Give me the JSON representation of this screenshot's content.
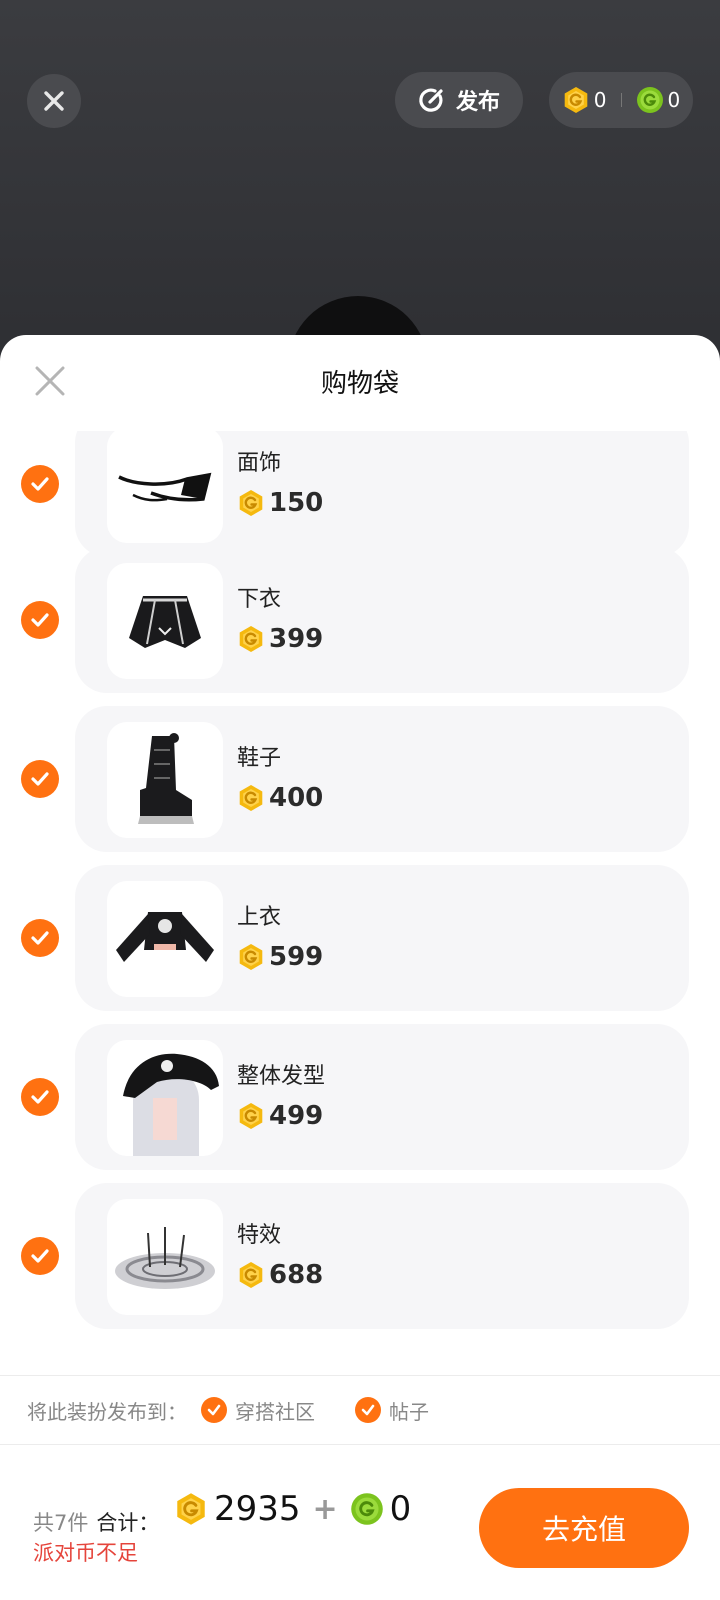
{
  "topbar": {
    "publish_label": "发布",
    "gold_balance": "0",
    "green_balance": "0"
  },
  "sheet": {
    "title": "购物袋",
    "items": [
      {
        "name": "面饰",
        "price": "150",
        "checked": true,
        "thumb_icon": "face-accessory-icon"
      },
      {
        "name": "下衣",
        "price": "399",
        "checked": true,
        "thumb_icon": "skirt-icon"
      },
      {
        "name": "鞋子",
        "price": "400",
        "checked": true,
        "thumb_icon": "boots-icon"
      },
      {
        "name": "上衣",
        "price": "599",
        "checked": true,
        "thumb_icon": "jacket-icon"
      },
      {
        "name": "整体发型",
        "price": "499",
        "checked": true,
        "thumb_icon": "hairstyle-icon"
      },
      {
        "name": "特效",
        "price": "688",
        "checked": true,
        "thumb_icon": "effect-icon"
      }
    ]
  },
  "publish": {
    "label": "将此装扮发布到：",
    "options": [
      {
        "label": "穿搭社区",
        "checked": true
      },
      {
        "label": "帖子",
        "checked": true
      }
    ]
  },
  "footer": {
    "count": "共7件",
    "total_label": "合计：",
    "gold_total": "2935",
    "plus": "+",
    "green_total": "0",
    "warning": "派对币不足",
    "recharge_label": "去充值"
  },
  "colors": {
    "accent": "#ff7111",
    "gold_coin": "#f5b90f",
    "green_coin": "#7cc31e",
    "warning": "#e5443b",
    "card_bg": "#f6f6f8"
  }
}
